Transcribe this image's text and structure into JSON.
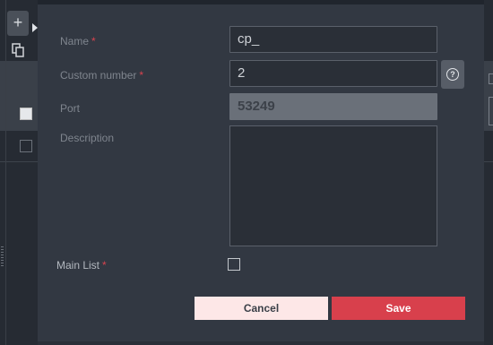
{
  "background": {
    "add_label": "+",
    "icons": [
      "plus-icon",
      "arrow-right-icon",
      "copy-icon",
      "checkbox",
      "checkbox"
    ]
  },
  "form": {
    "name": {
      "label": "Name",
      "required_mark": "*",
      "value": "cp_"
    },
    "custom_number": {
      "label": "Custom number",
      "required_mark": "*",
      "value": "2",
      "help_icon": "?"
    },
    "port": {
      "label": "Port",
      "value": "53249",
      "disabled": true
    },
    "description": {
      "label": "Description",
      "value": ""
    },
    "main_list": {
      "label": "Main List",
      "required_mark": "*",
      "checked": false
    }
  },
  "actions": {
    "cancel_label": "Cancel",
    "save_label": "Save"
  },
  "colors": {
    "accent": "#d8404c",
    "cancel_bg": "#fde7e7",
    "modal_bg": "#323842"
  }
}
